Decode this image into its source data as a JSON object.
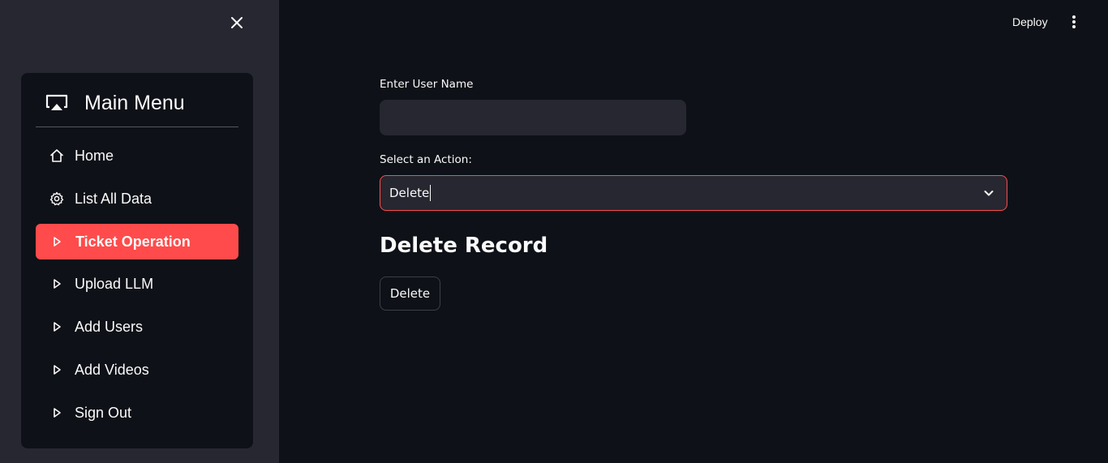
{
  "sidebar": {
    "close_icon": "close-icon",
    "menu_title": "Main Menu",
    "menu_icon": "airplay-icon",
    "items": [
      {
        "label": "Home",
        "icon": "house-icon",
        "active": false
      },
      {
        "label": "List All Data",
        "icon": "gear-icon",
        "active": false
      },
      {
        "label": "Ticket Operation",
        "icon": "play-outline-icon",
        "active": true
      },
      {
        "label": "Upload LLM",
        "icon": "play-outline-icon",
        "active": false
      },
      {
        "label": "Add Users",
        "icon": "play-outline-icon",
        "active": false
      },
      {
        "label": "Add Videos",
        "icon": "play-outline-icon",
        "active": false
      },
      {
        "label": "Sign Out",
        "icon": "play-outline-icon",
        "active": false
      }
    ],
    "active_color": "#ff4b4b"
  },
  "header": {
    "deploy_label": "Deploy",
    "menu_icon": "kebab-menu-icon"
  },
  "main": {
    "user_name_label": "Enter User Name",
    "user_name_value": "",
    "action_label": "Select an Action:",
    "action_value": "Delete",
    "section_heading": "Delete Record",
    "delete_button_label": "Delete"
  },
  "colors": {
    "background": "#0e1117",
    "sidebar_bg": "#262730",
    "accent": "#ff4b4b",
    "text": "#fafafa"
  }
}
